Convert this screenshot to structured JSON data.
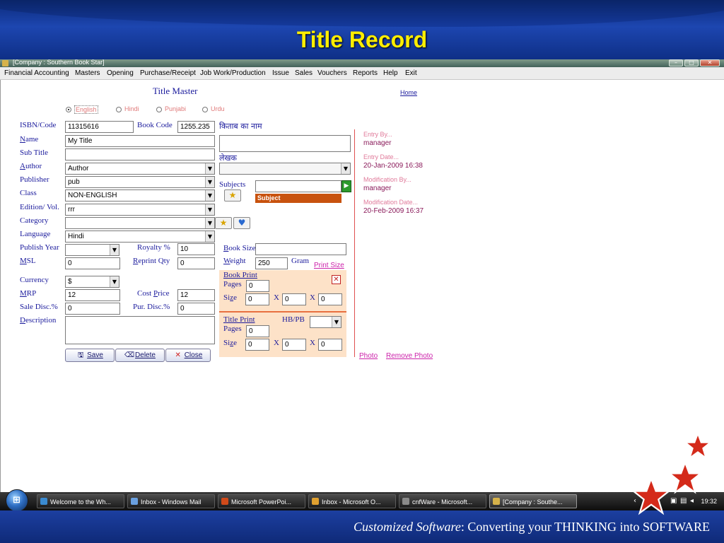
{
  "slide": {
    "title": "Title Record",
    "footer_italic": "Customized Software",
    "footer_rest": ":   Converting your THINKING into SOFTWARE"
  },
  "window": {
    "title": "[Company : Southern Book Star]"
  },
  "menu": [
    "Financial Accounting",
    "Masters",
    "Opening",
    "Purchase/Receipt",
    "Job Work/Production",
    "Issue",
    "Sales",
    "Vouchers",
    "Reports",
    "Help",
    "Exit"
  ],
  "form": {
    "heading": "Title Master",
    "home_link": "Home",
    "languages": [
      "English",
      "Hindi",
      "Punjabi",
      "Urdu"
    ],
    "isbn_label": "ISBN/Code",
    "isbn_value": "11315616",
    "book_code_label": "Book Code",
    "book_code_value": "1255.235",
    "hindi_title_label": "किताब का नाम",
    "name_label": "Name",
    "name_value": "My Title",
    "subtitle_label": "Sub Title",
    "subtitle_value": "",
    "author_label": "Author",
    "author_value": "Author",
    "hindi_author_label": "लेखक",
    "publisher_label": "Publisher",
    "publisher_value": "pub",
    "subjects_label": "Subjects",
    "subject_header": "Subject",
    "class_label": "Class",
    "class_value": "NON-ENGLISH",
    "edition_label": "Edition/ Vol.",
    "edition_value": "rrr",
    "category_label": "Category",
    "category_value": "",
    "language_label": "Language",
    "language_value": "Hindi",
    "publish_year_label": "Publish Year",
    "publish_year_value": "",
    "royalty_label": "Royalty %",
    "royalty_value": "10",
    "book_size_label": "Book Size",
    "book_size_value": "",
    "msl_label": "MSL",
    "msl_value": "0",
    "reprint_label": "Reprint Qty",
    "reprint_value": "0",
    "weight_label": "Weight",
    "weight_value": "250",
    "gram_label": "Gram",
    "print_size_link": "Print Size",
    "currency_label": "Currency",
    "currency_value": "$",
    "mrp_label": "MRP",
    "mrp_value": "12",
    "cost_price_label": "Cost Price",
    "cost_price_value": "12",
    "sale_disc_label": "Sale Disc.%",
    "sale_disc_value": "0",
    "pur_disc_label": "Pur. Disc.%",
    "pur_disc_value": "0",
    "description_label": "Description",
    "description_value": "",
    "book_print_label": "Book Print",
    "bp_pages_label": "Pages",
    "bp_pages_value": "0",
    "bp_size_label": "Size",
    "bp_size_a": "0",
    "bp_size_b": "0",
    "bp_size_c": "0",
    "x_label": "X",
    "title_print_label": "Title Print",
    "hbpb_label": "HB/PB",
    "hbpb_value": "",
    "tp_pages_label": "Pages",
    "tp_pages_value": "0",
    "tp_size_label": "Size",
    "tp_size_a": "0",
    "tp_size_b": "0",
    "tp_size_c": "0",
    "save_label": "Save",
    "delete_label": "Delete",
    "close_label": "Close",
    "photo_link": "Photo",
    "remove_photo_link": "Remove Photo"
  },
  "audit": {
    "entry_by_label": "Entry  By...",
    "entry_by_value": "manager",
    "entry_date_label": "Entry  Date...",
    "entry_date_value": "20-Jan-2009 16:38",
    "mod_by_label": "Modification  By...",
    "mod_by_value": "manager",
    "mod_date_label": "Modification  Date...",
    "mod_date_value": "20-Feb-2009 16:37"
  },
  "taskbar": {
    "items": [
      "Welcome to the Wh...",
      "Inbox - Windows Mail",
      "Microsoft PowerPoi...",
      "Inbox - Microsoft O...",
      "cnfWare - Microsoft...",
      "[Company : Southe..."
    ],
    "clock": "19:32"
  },
  "colors": {
    "title_yellow": "#ffee00",
    "label_blue": "#1a1a9c",
    "panel_peach": "#fde2c8",
    "subject_orange": "#c8520e",
    "star_red": "#d42a1a"
  }
}
